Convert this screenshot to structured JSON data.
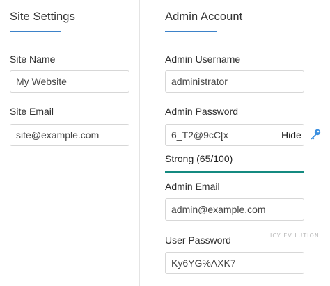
{
  "site_settings": {
    "title": "Site Settings",
    "site_name_label": "Site Name",
    "site_name_value": "My Website",
    "site_email_label": "Site Email",
    "site_email_value": "site@example.com"
  },
  "admin_account": {
    "title": "Admin Account",
    "username_label": "Admin Username",
    "username_value": "administrator",
    "password_label": "Admin Password",
    "password_value": "6_T2@9cC[x",
    "hide_label": "Hide",
    "password_icon": "key-icon",
    "strength_text": "Strong (65/100)",
    "strength_score": 65,
    "email_label": "Admin Email",
    "email_value": "admin@example.com",
    "user_password_label": "User Password",
    "user_password_value": "Ky6YG%AXK7"
  },
  "watermark": "ICY EV LUTION",
  "colors": {
    "accent": "#3d82c9",
    "strength": "#148a80",
    "key_icon": "#3a8fe0"
  }
}
